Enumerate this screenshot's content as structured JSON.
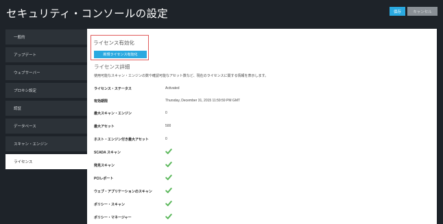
{
  "header": {
    "title": "セキュリティ・コンソールの設定",
    "save_label": "保存",
    "cancel_label": "キャンセル"
  },
  "sidebar": {
    "items": [
      {
        "label": "一般的"
      },
      {
        "label": "アップデート"
      },
      {
        "label": "ウェブサーバー"
      },
      {
        "label": "プロキシ設定"
      },
      {
        "label": "認証"
      },
      {
        "label": "データベース"
      },
      {
        "label": "スキャン・エンジン"
      },
      {
        "label": "ライセンス",
        "active": true
      }
    ]
  },
  "license": {
    "activation_title": "ライセンス有効化",
    "activate_button": "新規ライセンス有効化",
    "details_title": "ライセンス詳細",
    "details_description": "使用可能なスキャン・エンジンの数や確認可能なアセット数など、現在のライセンスに関する情報を表示します。",
    "rows": [
      {
        "label": "ライセンス・ステータス",
        "value": "Activated"
      },
      {
        "label": "有効期限",
        "value": "Thursday, December 31, 2015 11:59:59 PM GMT"
      },
      {
        "label": "最大スキャン・エンジン",
        "value": "0"
      },
      {
        "label": "最大アセット",
        "value": "500"
      },
      {
        "label": "ホスト・エンジン付き最大アセット",
        "value": "0"
      },
      {
        "label": "SCADA スキャン",
        "check": true
      },
      {
        "label": "発見スキャン",
        "check": true
      },
      {
        "label": "PCIレポート",
        "check": true
      },
      {
        "label": "ウェブ・アプリケーションのスキャン",
        "check": true
      },
      {
        "label": "ポリシー・スキャン",
        "check": true
      },
      {
        "label": "ポリシー・マネージャー",
        "check": true
      }
    ]
  },
  "colors": {
    "accent": "#2aa9e0",
    "check": "#5cb85c",
    "highlight_border": "#e05a5a"
  }
}
